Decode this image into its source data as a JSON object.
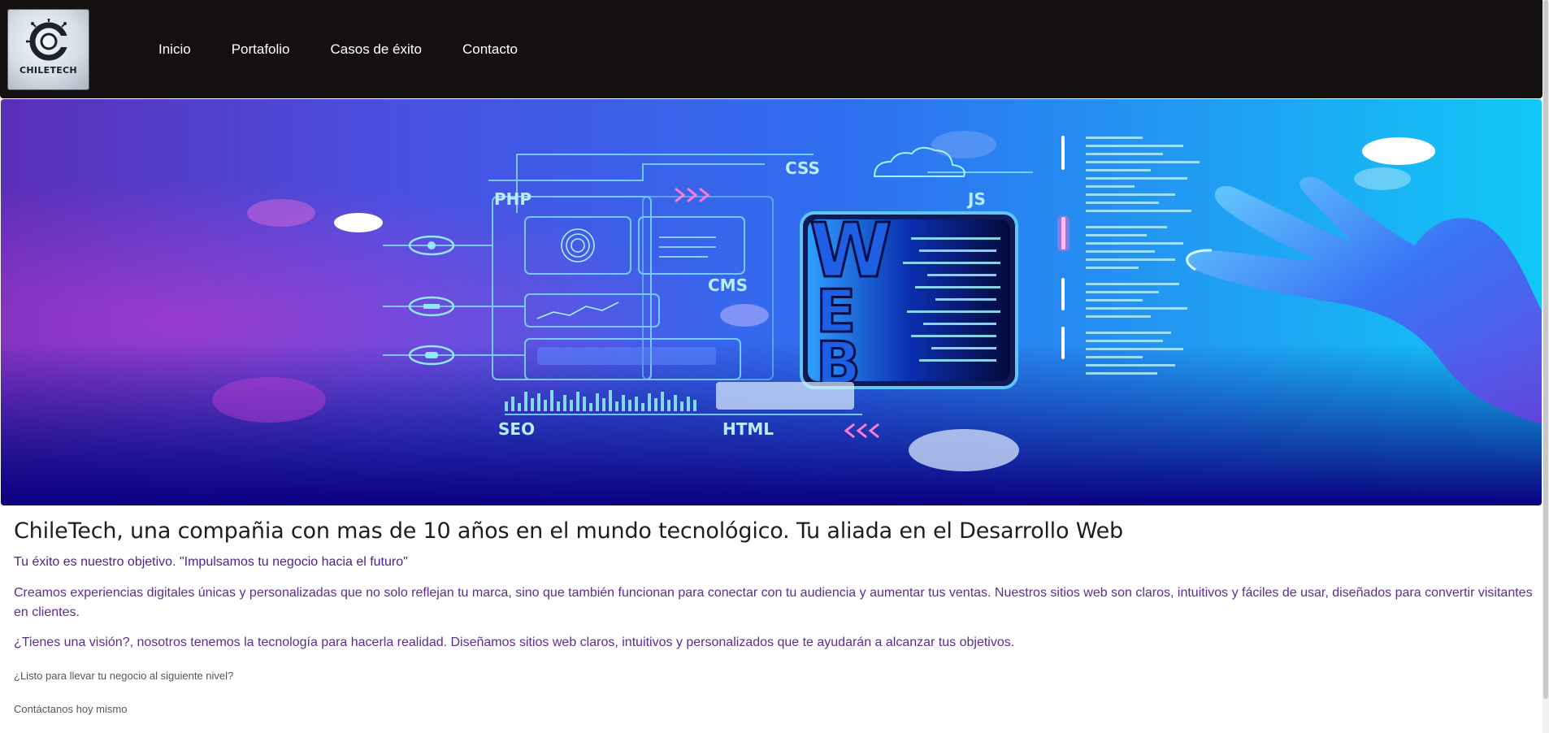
{
  "brand": {
    "logo_text": "CHILETECH"
  },
  "nav": {
    "items": [
      {
        "label": "Inicio"
      },
      {
        "label": "Portafolio"
      },
      {
        "label": "Casos de éxito"
      },
      {
        "label": "Contacto"
      }
    ]
  },
  "hero": {
    "labels": [
      "PHP",
      "CSS",
      "JS",
      "CMS",
      "SEO",
      "HTML",
      "WEB"
    ]
  },
  "content": {
    "headline": "ChileTech, una compañia con mas de 10 años en el mundo tecnológico. Tu aliada en el Desarrollo Web",
    "tagline": "Tu éxito es nuestro objetivo. \"Impulsamos tu negocio hacia el futuro\"",
    "paragraph1": "Creamos experiencias digitales únicas y personalizadas que no solo reflejan tu marca, sino que también funcionan para conectar con tu audiencia y aumentar tus ventas. Nuestros sitios web son claros, intuitivos y fáciles de usar, diseñados para convertir visitantes en clientes.",
    "paragraph2": "¿Tienes una visión?, nosotros tenemos la tecnología para hacerla realidad. Diseñamos sitios web claros, intuitivos y personalizados que te ayudarán a alcanzar tus objetivos.",
    "cta_question": "¿Listo para llevar tu negocio al siguiente nivel?",
    "cta_contact": "Contáctanos hoy mismo"
  },
  "colors": {
    "navbar_bg": "#141010",
    "text_purple": "#5d2c92"
  }
}
